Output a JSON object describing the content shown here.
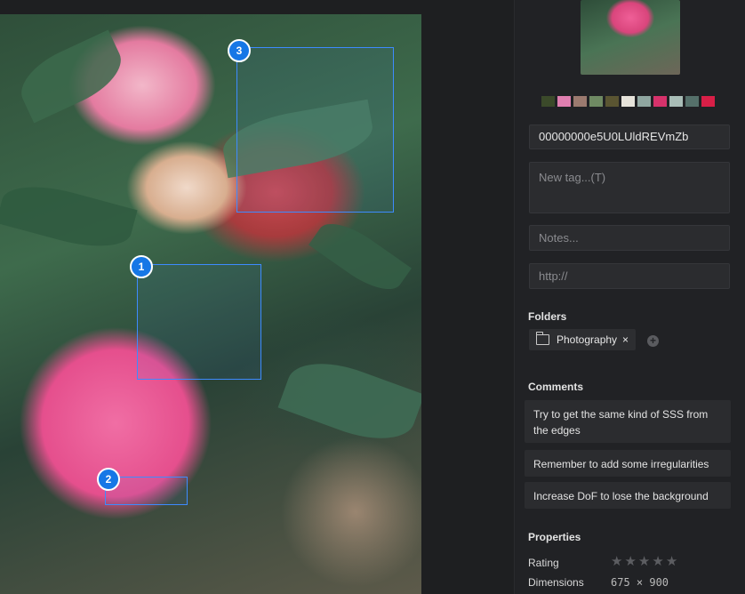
{
  "image": {
    "annotations": [
      {
        "number": "1",
        "label": "annotation-1"
      },
      {
        "number": "2",
        "label": "annotation-2"
      },
      {
        "number": "3",
        "label": "annotation-3"
      }
    ]
  },
  "sidebar": {
    "palette": [
      "#3b4a2a",
      "#e07fb0",
      "#9b7a6f",
      "#6f8a63",
      "#5a5532",
      "#e6e3da",
      "#8fa6a0",
      "#d6326b",
      "#a9bdb7",
      "#55706a",
      "#d81f47"
    ],
    "id_field": "00000000e5U0LUldREVmZb",
    "tag_placeholder": "New tag...(T)",
    "notes_placeholder": "Notes...",
    "url_placeholder": "http://",
    "folders_title": "Folders",
    "folder_chip": "Photography",
    "folder_remove": "×",
    "folder_add": "+",
    "comments_title": "Comments",
    "comments": [
      "Try to get the same kind of SSS from the edges",
      "Remember to add some irregularities",
      "Increase DoF to lose the background"
    ],
    "properties_title": "Properties",
    "rating_label": "Rating",
    "rating_value": 0,
    "rating_max": 5,
    "dimensions_label": "Dimensions",
    "dimensions_value": "675 × 900"
  }
}
